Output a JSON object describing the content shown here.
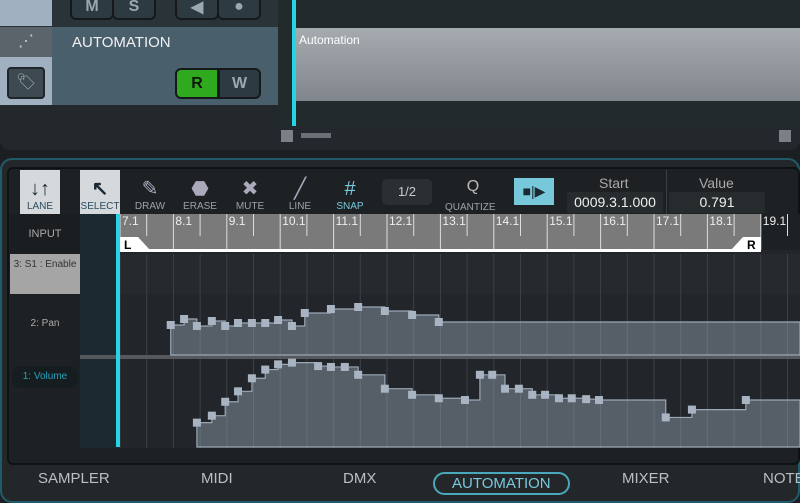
{
  "track": {
    "name": "AUTOMATION",
    "clip_label": "Automation",
    "buttons": {
      "mute": "M",
      "solo": "S",
      "read": "R",
      "write": "W"
    },
    "read_active": true
  },
  "toolbar": {
    "tools": [
      {
        "label": "LANE",
        "icon": "lane-arrows-icon",
        "active": true
      },
      {
        "label": "SELECT",
        "icon": "cursor-icon",
        "active": true
      },
      {
        "label": "DRAW",
        "icon": "pencil-icon"
      },
      {
        "label": "ERASE",
        "icon": "eraser-icon"
      },
      {
        "label": "MUTE",
        "icon": "x-icon"
      },
      {
        "label": "LINE",
        "icon": "line-icon"
      },
      {
        "label": "SNAP",
        "icon": "grid-icon",
        "active": true
      }
    ],
    "snap_value": "1/2",
    "quantize_letter": "Q",
    "quantize_label": "QUANTIZE",
    "start_label": "Start",
    "start_value": "0009.3.1.000",
    "value_label": "Value",
    "value_value": "0.791"
  },
  "ruler": {
    "ticks": [
      "7.1",
      "8.1",
      "9.1",
      "10.1",
      "11.1",
      "12.1",
      "13.1",
      "14.1",
      "15.1",
      "16.1",
      "17.1",
      "18.1",
      "19.1"
    ],
    "loop_left": "L",
    "loop_right": "R"
  },
  "lanes": {
    "input": "INPUT",
    "lane3": "3: S1 : Enable",
    "lane2": "2: Pan",
    "lane1": "1: Volume"
  },
  "automation": {
    "pan": [
      [
        7.95,
        0.3
      ],
      [
        8.2,
        0.36
      ],
      [
        8.44,
        0.29
      ],
      [
        8.72,
        0.34
      ],
      [
        8.97,
        0.29
      ],
      [
        9.21,
        0.32
      ],
      [
        9.47,
        0.32
      ],
      [
        9.72,
        0.32
      ],
      [
        9.96,
        0.35
      ],
      [
        10.22,
        0.29
      ],
      [
        10.46,
        0.42
      ],
      [
        10.95,
        0.46
      ],
      [
        11.46,
        0.48
      ],
      [
        11.96,
        0.44
      ],
      [
        12.47,
        0.4
      ],
      [
        12.97,
        0.33
      ]
    ],
    "volume": [
      [
        8.44,
        0.28
      ],
      [
        8.72,
        0.36
      ],
      [
        8.97,
        0.52
      ],
      [
        9.21,
        0.64
      ],
      [
        9.47,
        0.79
      ],
      [
        9.72,
        0.89
      ],
      [
        9.96,
        0.95
      ],
      [
        10.22,
        0.97
      ],
      [
        10.71,
        0.93
      ],
      [
        10.95,
        0.92
      ],
      [
        11.21,
        0.92
      ],
      [
        11.46,
        0.83
      ],
      [
        11.96,
        0.67
      ],
      [
        12.47,
        0.6
      ],
      [
        12.97,
        0.56
      ],
      [
        13.46,
        0.54
      ],
      [
        13.74,
        0.83
      ],
      [
        13.97,
        0.83
      ],
      [
        14.21,
        0.67
      ],
      [
        14.47,
        0.67
      ],
      [
        14.72,
        0.6
      ],
      [
        14.96,
        0.6
      ],
      [
        15.22,
        0.56
      ],
      [
        15.46,
        0.56
      ],
      [
        15.73,
        0.55
      ],
      [
        15.97,
        0.54
      ],
      [
        17.22,
        0.34
      ],
      [
        17.71,
        0.43
      ],
      [
        18.72,
        0.54
      ]
    ]
  },
  "tabs": [
    "SAMPLER",
    "MIDI",
    "DMX",
    "AUTOMATION",
    "MIXER",
    "NOTE"
  ],
  "active_tab": "AUTOMATION",
  "colors": {
    "accent": "#27d3e6",
    "read_green": "#2faa1e",
    "snap_active": "#78c8dc"
  }
}
